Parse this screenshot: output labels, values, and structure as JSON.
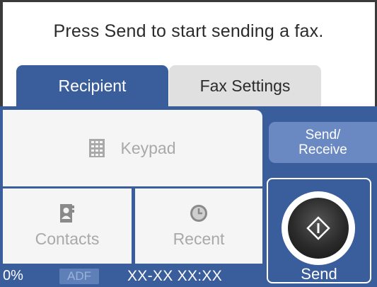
{
  "message": "Press Send to start sending a fax.",
  "tabs": {
    "recipient": "Recipient",
    "fax_settings": "Fax Settings"
  },
  "buttons": {
    "keypad": {
      "label": "Keypad",
      "icon": "keypad-icon"
    },
    "contacts": {
      "label": "Contacts",
      "icon": "contacts-icon"
    },
    "recent": {
      "label": "Recent",
      "icon": "clock-icon"
    },
    "send_receive": {
      "line1": "Send/",
      "line2": "Receive"
    },
    "send": {
      "label": "Send",
      "icon": "start-diamond-icon"
    }
  },
  "status_bar": {
    "progress": "0%",
    "adf": "ADF",
    "datetime": "XX-XX XX:XX"
  },
  "colors": {
    "primary": "#3a5d9c",
    "secondary_button": "#6a89c2",
    "disabled_text": "#a9a9a9",
    "inactive_tab": "#e0e0e0"
  }
}
